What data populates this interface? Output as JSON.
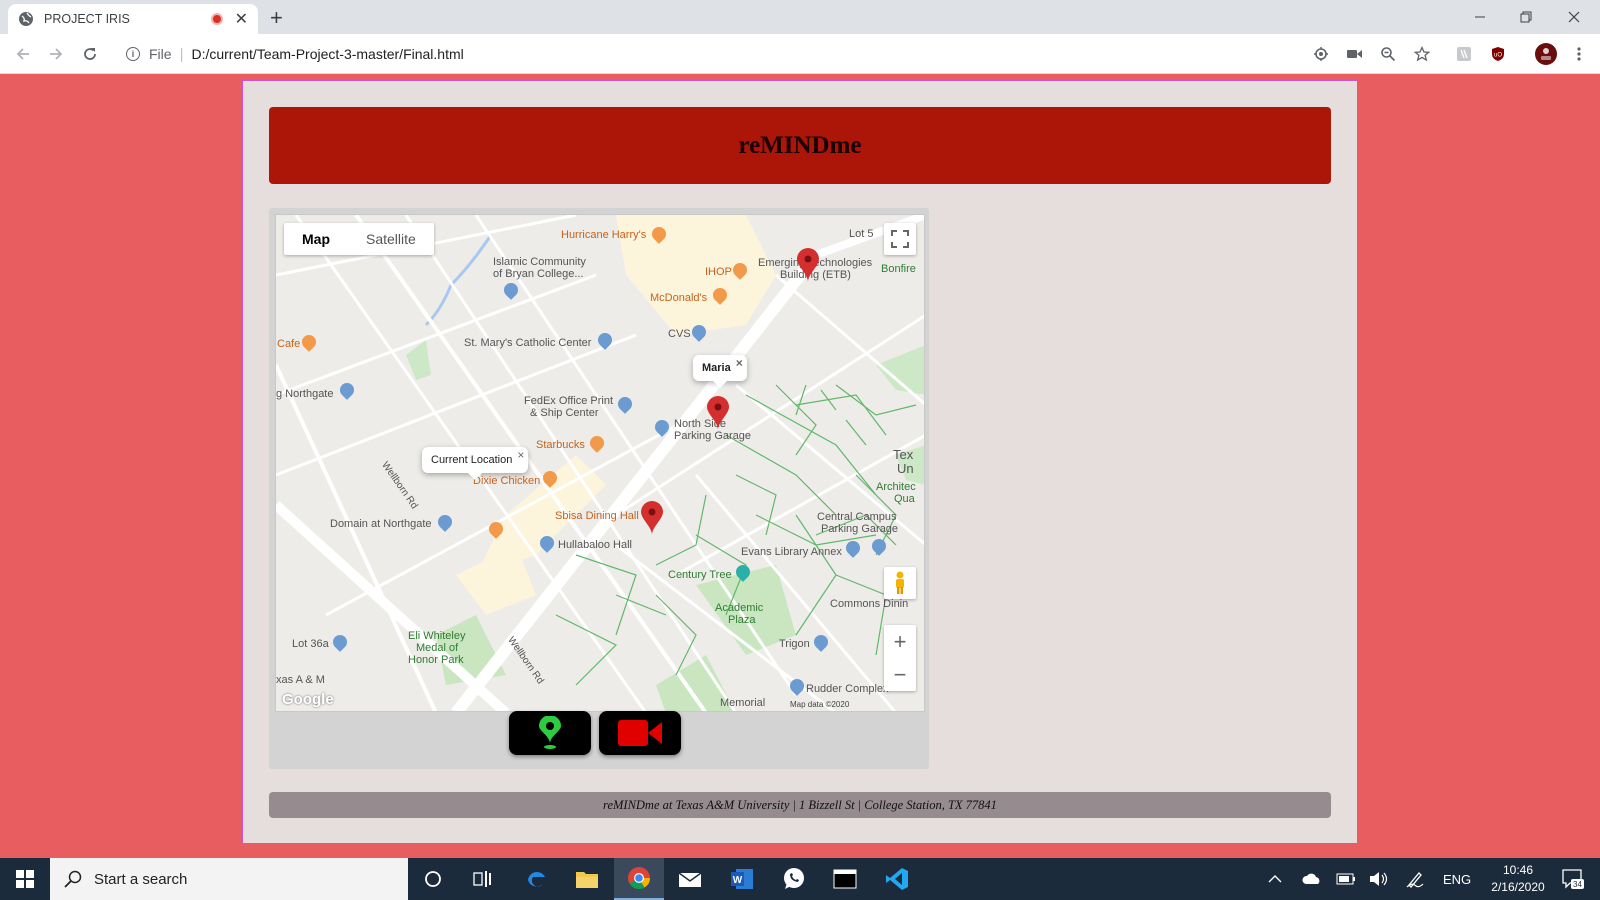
{
  "browser": {
    "tab_title": "PROJECT IRIS",
    "tab_close": "✕",
    "new_tab": "+",
    "url_scheme": "File",
    "url": "D:/current/Team-Project-3-master/Final.html"
  },
  "page": {
    "title": "reMINDme",
    "footer": "reMINDme at Texas A&M University | 1 Bizzell St | College Station, TX 77841"
  },
  "map": {
    "type_buttons": [
      "Map",
      "Satellite"
    ],
    "active_type": "Map",
    "info_windows": {
      "maria": "Maria",
      "current": "Current Location"
    },
    "labels": {
      "hurricane": "Hurricane Harry's",
      "islamic": "Islamic Community",
      "islamic2": "of Bryan College...",
      "ihop": "IHOP",
      "mcdonalds": "McDonald's",
      "emerging": "Emerging Technologies",
      "etb": "Building (ETB)",
      "bonfire": "Bonfire",
      "lot5": "Lot 5",
      "cafe": "Cafe",
      "stmarys": "St. Mary's Catholic Center",
      "cvs": "CVS",
      "northgate": "g Northgate",
      "fedex": "FedEx Office Print",
      "fedex2": "& Ship Center",
      "northside": "North Side",
      "northside2": "Parking Garage",
      "starbucks": "Starbucks",
      "dixie": "Dixie Chicken",
      "domain": "Domain at Northgate",
      "sbisa": "Sbisa Dining Hall",
      "hullabaloo": "Hullabaloo Hall",
      "central": "Central Campus",
      "central2": "Parking Garage",
      "evans": "Evans Library Annex",
      "century": "Century Tree",
      "academic": "Academic",
      "academic2": "Plaza",
      "commons": "Commons Dinin",
      "trigon": "Trigon",
      "lot36": "Lot 36a",
      "eli": "Eli Whiteley",
      "eli2": "Medal of",
      "eli3": "Honor Park",
      "rudder": "Rudder Complex",
      "memorial": "Memorial",
      "texas": "Tex",
      "texas2": "Un",
      "archi": "Architec",
      "archi2": "Qua",
      "xas": "xas A & M",
      "wellborn": "Wellborn Rd",
      "wellborn2": "Wellborn Rd",
      "google": "Google",
      "mapdata": "Map data ©2020"
    },
    "zoom_in": "+",
    "zoom_out": "−"
  },
  "taskbar": {
    "search_placeholder": "Start a search",
    "lang": "ENG",
    "time": "10:46",
    "date": "2/16/2020",
    "notifications": "34"
  },
  "colors": {
    "page_bg": "#e85e60",
    "header_bg": "#ab1608",
    "marker_red": "#d32f2f",
    "pin_green": "#2ecc40",
    "camera_red": "#e00000"
  },
  "icons": [
    "globe-icon",
    "back-icon",
    "forward-icon",
    "reload-icon",
    "info-icon",
    "location-icon",
    "camera-icon",
    "zoom-icon",
    "star-icon",
    "extension-icon",
    "shield-icon",
    "avatar",
    "menu-icon",
    "fullscreen-icon",
    "pegman-icon",
    "map-marker-icon",
    "pin-icon",
    "video-camera-icon",
    "windows-icon",
    "search-icon",
    "cortana-icon",
    "task-view-icon",
    "edge-icon",
    "file-explorer-icon",
    "chrome-icon",
    "mail-icon",
    "word-icon",
    "whatsapp-icon",
    "terminal-icon",
    "vscode-icon",
    "chevron-up-icon",
    "cloud-icon",
    "battery-icon",
    "volume-icon",
    "pen-icon",
    "notification-icon"
  ]
}
